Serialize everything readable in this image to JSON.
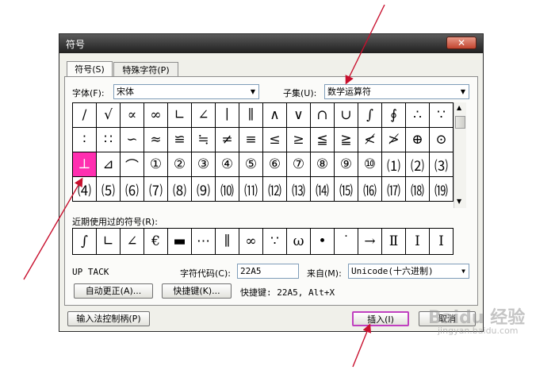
{
  "dialog": {
    "title": "符号",
    "close_glyph": "✕"
  },
  "tabs": [
    {
      "label": "符号(S)"
    },
    {
      "label": "特殊字符(P)"
    }
  ],
  "font": {
    "label": "字体(F):",
    "value": "宋体"
  },
  "subset": {
    "label": "子集(U):",
    "value": "数学运算符"
  },
  "symbols": [
    [
      "∕",
      "√",
      "∝",
      "∞",
      "∟",
      "∠",
      "∣",
      "∥",
      "∧",
      "∨",
      "∩",
      "∪",
      "∫",
      "∮",
      "∴",
      "∵"
    ],
    [
      "∶",
      "∷",
      "∽",
      "≈",
      "≌",
      "≒",
      "≠",
      "≡",
      "≤",
      "≥",
      "≦",
      "≧",
      "≮",
      "≯",
      "⊕",
      "⊙"
    ],
    [
      "⊥",
      "⊿",
      "⌒",
      "①",
      "②",
      "③",
      "④",
      "⑤",
      "⑥",
      "⑦",
      "⑧",
      "⑨",
      "⑩",
      "⑴",
      "⑵",
      "⑶"
    ],
    [
      "⑷",
      "⑸",
      "⑹",
      "⑺",
      "⑻",
      "⑼",
      "⑽",
      "⑾",
      "⑿",
      "⒀",
      "⒁",
      "⒂",
      "⒃",
      "⒄",
      "⒅",
      "⒆"
    ]
  ],
  "recent": {
    "label": "近期使用过的符号(R):",
    "items": [
      "∫",
      "∟",
      "∠",
      "€",
      "▬",
      "⋯",
      "∥",
      "∞",
      "∵",
      "ω",
      "•",
      "˙",
      "→",
      "Ⅱ",
      "Ⅰ",
      "I"
    ]
  },
  "char_name": "UP TACK",
  "char_code": {
    "label": "字符代码(C):",
    "value": "22A5"
  },
  "from": {
    "label": "来自(M):",
    "value": "Unicode(十六进制)"
  },
  "buttons": {
    "autocorrect": "自动更正(A)...",
    "shortcut_key": "快捷键(K)...",
    "ime": "输入法控制柄(P)",
    "insert": "插入(I)",
    "cancel": "取消"
  },
  "shortcut_text": "快捷键: 22A5, Alt+X",
  "watermark": {
    "text": "Baidu 经验",
    "sub": "jingyan.baidu.com"
  },
  "colors": {
    "selected": "#ff2fb0",
    "annotation_arrow": "#c8102e"
  }
}
